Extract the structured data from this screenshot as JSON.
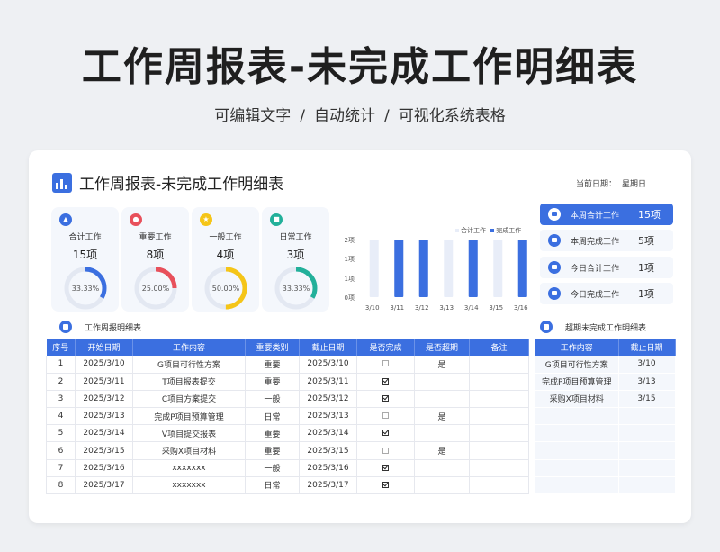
{
  "header": {
    "title": "工作周报表-未完成工作明细表",
    "subtitle": [
      "可编辑文字",
      "/",
      "自动统计",
      "/",
      "可视化系统表格"
    ]
  },
  "dashboard": {
    "title": "工作周报表-未完成工作明细表",
    "date_label": "当前日期：",
    "date_value": "星期日"
  },
  "stats": [
    {
      "label": "合计工作",
      "count": "15项",
      "percent_text": "33.33%",
      "fraction": 0.3333,
      "color": "#3b6fe0"
    },
    {
      "label": "重要工作",
      "count": "8项",
      "percent_text": "25.00%",
      "fraction": 0.25,
      "color": "#e8505b"
    },
    {
      "label": "一般工作",
      "count": "4项",
      "percent_text": "50.00%",
      "fraction": 0.5,
      "color": "#f5c518"
    },
    {
      "label": "日常工作",
      "count": "3项",
      "percent_text": "33.33%",
      "fraction": 0.3333,
      "color": "#22b09a"
    }
  ],
  "chart_data": {
    "type": "bar",
    "categories": [
      "3/10",
      "3/11",
      "3/12",
      "3/13",
      "3/14",
      "3/15",
      "3/16"
    ],
    "series": [
      {
        "name": "合计工作",
        "values": [
          2,
          2,
          2,
          2,
          2,
          2,
          2
        ],
        "color": "#e8edf8"
      },
      {
        "name": "完成工作",
        "values": [
          0,
          2,
          2,
          0,
          2,
          0,
          2
        ],
        "color": "#3b6fe0"
      }
    ],
    "yticks": [
      "0项",
      "1项",
      "1项",
      "2项"
    ],
    "ylim": [
      0,
      2
    ],
    "legend": "top-right"
  },
  "side_stats": [
    {
      "label": "本周合计工作",
      "value": "15项",
      "active": true
    },
    {
      "label": "本周完成工作",
      "value": "5项",
      "active": false
    },
    {
      "label": "今日合计工作",
      "value": "1项",
      "active": false
    },
    {
      "label": "今日完成工作",
      "value": "1项",
      "active": false
    }
  ],
  "detail": {
    "section_label": "工作周报明细表",
    "columns": [
      "序号",
      "开始日期",
      "工作内容",
      "重要类别",
      "截止日期",
      "是否完成",
      "是否超期",
      "备注"
    ],
    "rows": [
      {
        "no": "1",
        "start": "2025/3/10",
        "content": "G项目可行性方案",
        "category": "重要",
        "deadline": "2025/3/10",
        "done": false,
        "overdue": "是",
        "note": ""
      },
      {
        "no": "2",
        "start": "2025/3/11",
        "content": "T项目报表提交",
        "category": "重要",
        "deadline": "2025/3/11",
        "done": true,
        "overdue": "",
        "note": ""
      },
      {
        "no": "3",
        "start": "2025/3/12",
        "content": "C项目方案提交",
        "category": "一般",
        "deadline": "2025/3/12",
        "done": true,
        "overdue": "",
        "note": ""
      },
      {
        "no": "4",
        "start": "2025/3/13",
        "content": "完成P项目预算管理",
        "category": "日常",
        "deadline": "2025/3/13",
        "done": false,
        "overdue": "是",
        "note": ""
      },
      {
        "no": "5",
        "start": "2025/3/14",
        "content": "V项目提交报表",
        "category": "重要",
        "deadline": "2025/3/14",
        "done": true,
        "overdue": "",
        "note": ""
      },
      {
        "no": "6",
        "start": "2025/3/15",
        "content": "采购X项目材料",
        "category": "重要",
        "deadline": "2025/3/15",
        "done": false,
        "overdue": "是",
        "note": ""
      },
      {
        "no": "7",
        "start": "2025/3/16",
        "content": "xxxxxxx",
        "category": "一般",
        "deadline": "2025/3/16",
        "done": true,
        "overdue": "",
        "note": ""
      },
      {
        "no": "8",
        "start": "2025/3/17",
        "content": "xxxxxxx",
        "category": "日常",
        "deadline": "2025/3/17",
        "done": true,
        "overdue": "",
        "note": ""
      }
    ]
  },
  "overdue": {
    "section_label": "超期未完成工作明细表",
    "columns": [
      "工作内容",
      "截止日期"
    ],
    "rows": [
      {
        "content": "G项目可行性方案",
        "deadline": "3/10"
      },
      {
        "content": "完成P项目预算管理",
        "deadline": "3/13"
      },
      {
        "content": "采购X项目材料",
        "deadline": "3/15"
      },
      {
        "content": "",
        "deadline": ""
      },
      {
        "content": "",
        "deadline": ""
      },
      {
        "content": "",
        "deadline": ""
      },
      {
        "content": "",
        "deadline": ""
      },
      {
        "content": "",
        "deadline": ""
      }
    ]
  }
}
